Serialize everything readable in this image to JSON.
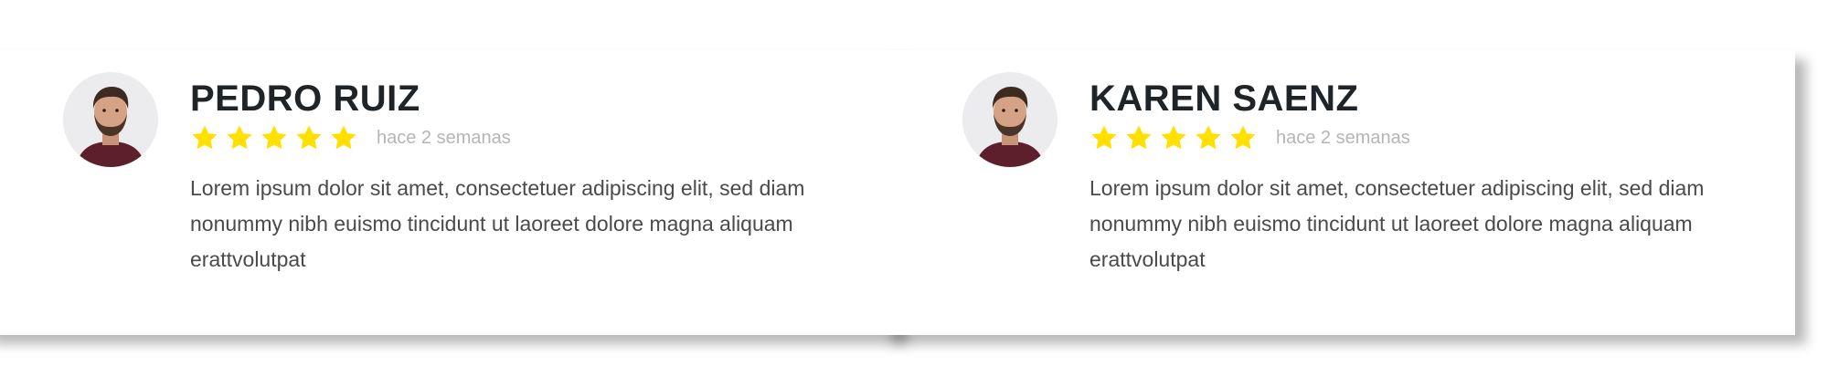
{
  "reviews": [
    {
      "name": "PEDRO RUIZ",
      "rating": 5,
      "time": "hace 2 semanas",
      "text": "Lorem ipsum dolor sit amet, consectetuer adipiscing elit, sed diam nonummy nibh euismo tincidunt ut laoreet dolore magna aliquam erattvolutpat"
    },
    {
      "name": "KAREN SAENZ",
      "rating": 5,
      "time": "hace 2 semanas",
      "text": "Lorem ipsum dolor sit amet, consectetuer adipiscing elit, sed diam nonummy nibh euismo tincidunt ut laoreet dolore magna aliquam erattvolutpat"
    }
  ],
  "colors": {
    "star": "#ffe000",
    "name": "#1f2428",
    "time": "#b5b5b5",
    "text": "#4a4a4a"
  }
}
